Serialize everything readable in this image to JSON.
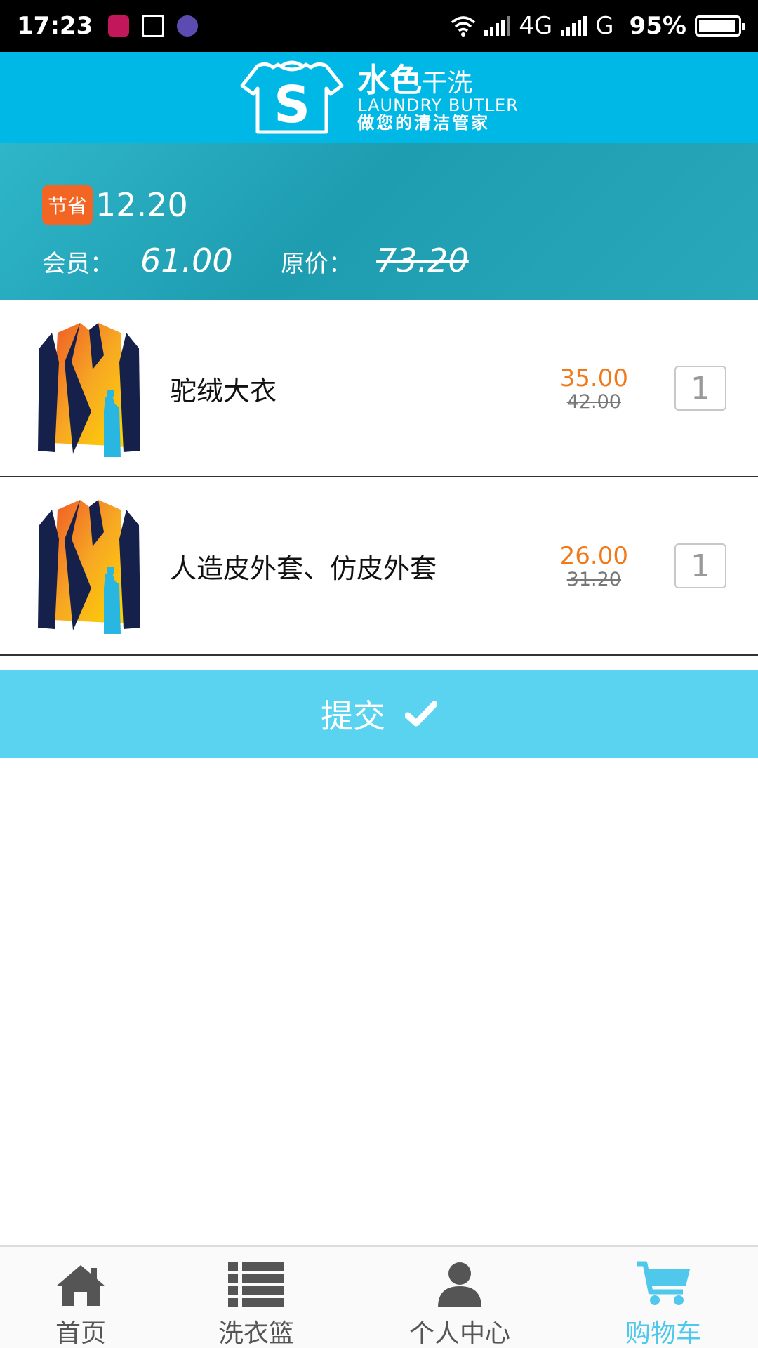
{
  "status_bar": {
    "time": "17:23",
    "network1": "4G",
    "network2": "G",
    "battery": "95%",
    "battery_level": 0.95
  },
  "header": {
    "brand_cn": "水色",
    "brand_cn_suffix": "干洗",
    "brand_en": "LAUNDRY BUTLER",
    "slogan": "做您的清洁管家",
    "logo_letter": "S"
  },
  "summary": {
    "save_badge": "节省",
    "save_amount": "12.20",
    "member_label": "会员：",
    "member_price": "61.00",
    "original_label": "原价：",
    "original_price": "73.20"
  },
  "items": [
    {
      "name": "驼绒大衣",
      "price": "35.00",
      "original_price": "42.00",
      "quantity": "1"
    },
    {
      "name": "人造皮外套、仿皮外套",
      "price": "26.00",
      "original_price": "31.20",
      "quantity": "1"
    }
  ],
  "submit": {
    "label": "提交"
  },
  "tabbar": {
    "tabs": [
      {
        "label": "首页",
        "icon": "home-icon"
      },
      {
        "label": "洗衣篮",
        "icon": "list-icon"
      },
      {
        "label": "个人中心",
        "icon": "user-icon"
      },
      {
        "label": "购物车",
        "icon": "cart-icon"
      }
    ],
    "active": "购物车"
  },
  "colors": {
    "header": "#00b8e6",
    "accent_orange": "#f07a1a",
    "badge_orange": "#f26522",
    "submit": "#59d3f0",
    "active_tab": "#4fc8ec"
  }
}
